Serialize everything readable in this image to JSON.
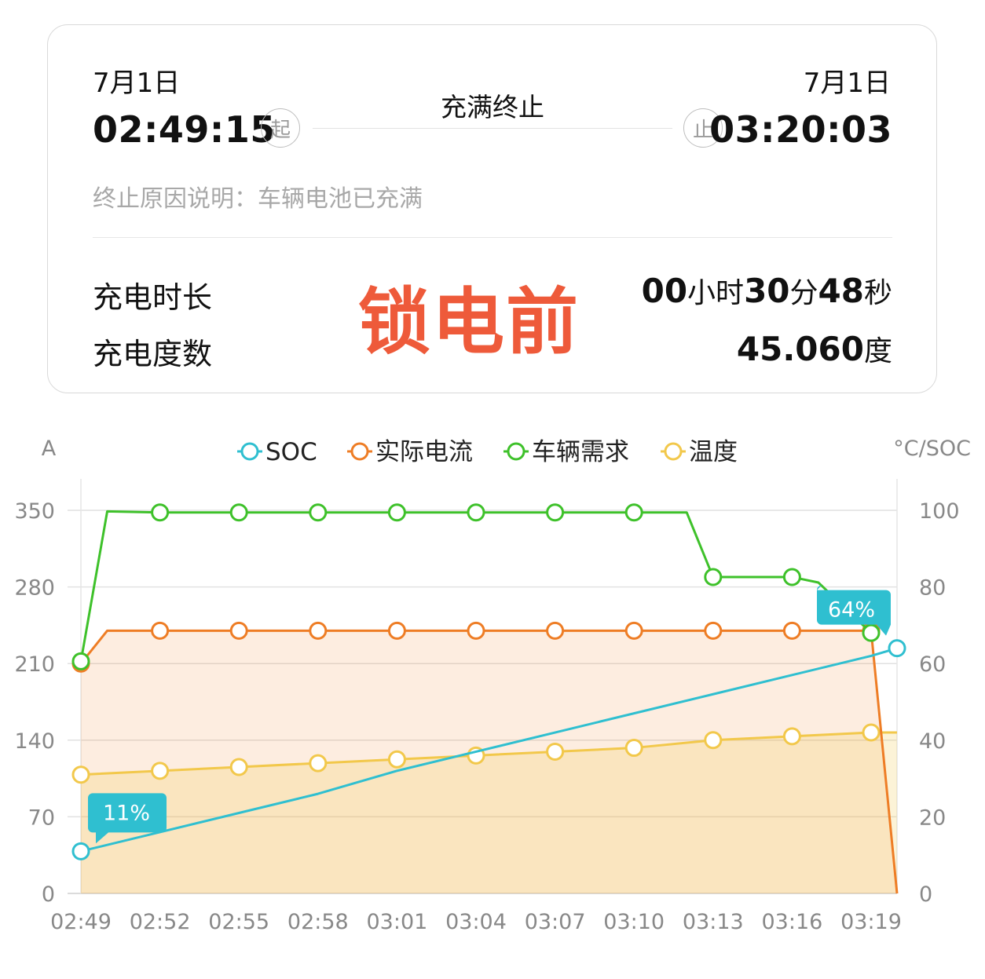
{
  "session": {
    "start_date": "7月1日",
    "start_time": "02:49:15",
    "start_badge": "起",
    "end_date": "7月1日",
    "end_time": "03:20:03",
    "end_badge": "止",
    "status": "充满终止",
    "reason": "终止原因说明：车辆电池已充满"
  },
  "stats": {
    "duration_label": "充电时长",
    "duration_hours": "00",
    "duration_hours_unit": "小时",
    "duration_minutes": "30",
    "duration_minutes_unit": "分",
    "duration_seconds": "48",
    "duration_seconds_unit": "秒",
    "energy_label": "充电度数",
    "energy_value": "45.060",
    "energy_unit": "度"
  },
  "watermark": "锁电前",
  "colors": {
    "soc": "#2fbfd0",
    "current": "#ee7d25",
    "demand": "#3ec12a",
    "temperature": "#f2c84b",
    "watermark": "#ee5a3a"
  },
  "chart_data": {
    "type": "line",
    "left_axis_label": "A",
    "right_axis_label": "°C/SOC",
    "left_ylim": [
      0,
      350
    ],
    "left_ticks": [
      0,
      70,
      140,
      210,
      280,
      350
    ],
    "right_ylim": [
      0,
      100
    ],
    "right_ticks": [
      0,
      20,
      40,
      60,
      80,
      100
    ],
    "x_ticks": [
      "02:49",
      "02:52",
      "02:55",
      "02:58",
      "03:01",
      "03:04",
      "03:07",
      "03:10",
      "03:13",
      "03:16",
      "03:19"
    ],
    "x_minutes": [
      0,
      3,
      6,
      9,
      12,
      15,
      18,
      21,
      24,
      27,
      30
    ],
    "grid": true,
    "legend_position": "top",
    "series": [
      {
        "name": "SOC",
        "axis": "right",
        "x": [
          0,
          3,
          6,
          9,
          12,
          15,
          18,
          21,
          24,
          27,
          30,
          31
        ],
        "y": [
          11,
          16,
          21,
          26,
          32,
          37,
          42,
          47,
          52,
          57,
          62,
          64
        ],
        "markers": [
          0,
          31
        ],
        "color_key": "soc",
        "area": false
      },
      {
        "name": "实际电流",
        "axis": "left",
        "x": [
          0,
          1,
          3,
          6,
          9,
          12,
          15,
          18,
          21,
          24,
          27,
          30,
          31
        ],
        "y": [
          210,
          240,
          240,
          240,
          240,
          240,
          240,
          240,
          240,
          240,
          240,
          240,
          0
        ],
        "markers": [
          0,
          3,
          6,
          9,
          12,
          15,
          18,
          21,
          24,
          27,
          30
        ],
        "color_key": "current",
        "area": true
      },
      {
        "name": "车辆需求",
        "axis": "left",
        "x": [
          0,
          1,
          3,
          6,
          9,
          12,
          15,
          18,
          21,
          23,
          24,
          27,
          28,
          30
        ],
        "y": [
          212,
          349,
          348,
          348,
          348,
          348,
          348,
          348,
          348,
          348,
          289,
          289,
          284,
          238
        ],
        "markers": [
          0,
          3,
          6,
          9,
          12,
          15,
          18,
          21,
          24,
          27,
          30
        ],
        "color_key": "demand",
        "area": false
      },
      {
        "name": "温度",
        "axis": "right",
        "x": [
          0,
          3,
          6,
          9,
          12,
          15,
          18,
          21,
          24,
          27,
          30,
          31
        ],
        "y": [
          31,
          32,
          33,
          34,
          35,
          36,
          37,
          38,
          40,
          41,
          42,
          42
        ],
        "markers": [
          0,
          3,
          6,
          9,
          12,
          15,
          18,
          21,
          24,
          27,
          30
        ],
        "color_key": "temperature",
        "area": true
      }
    ],
    "callouts": [
      {
        "series": "SOC",
        "x": 0,
        "text": "11%"
      },
      {
        "series": "SOC",
        "x": 31,
        "text": "64%"
      }
    ]
  }
}
